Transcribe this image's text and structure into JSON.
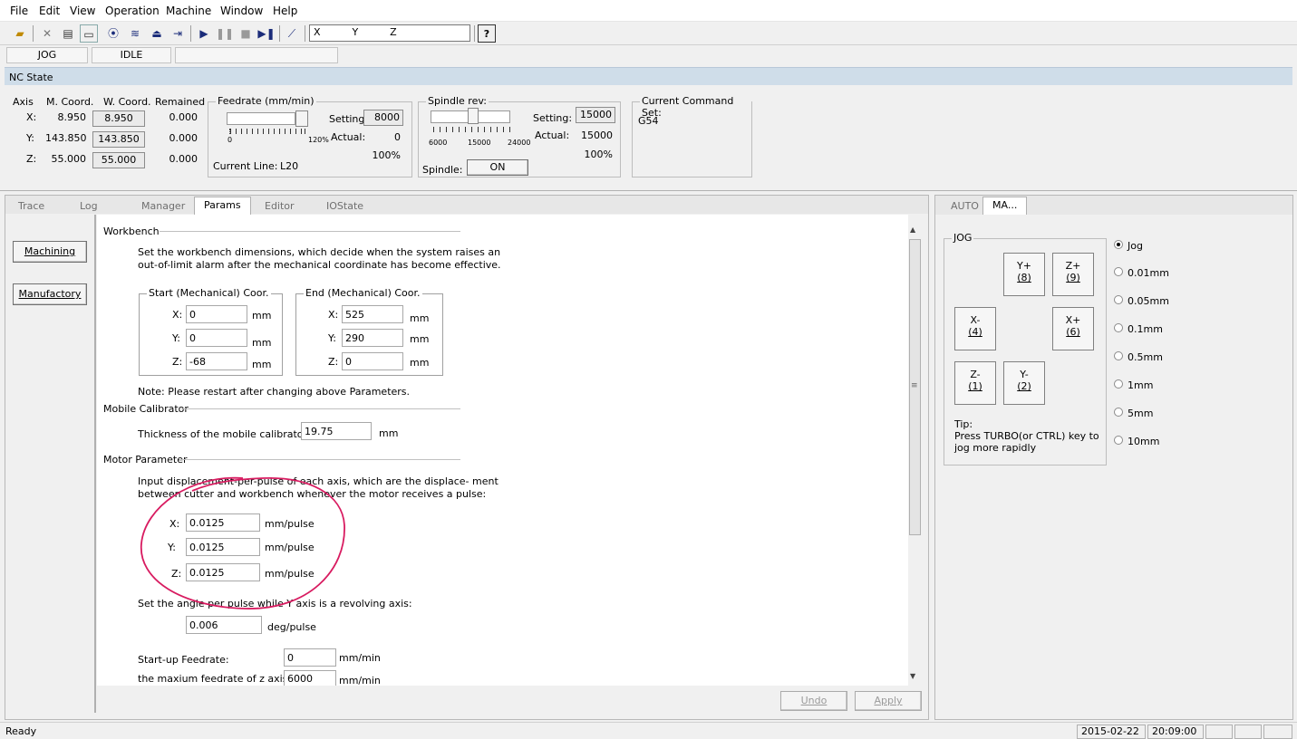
{
  "menu": [
    "File",
    "Edit",
    "View",
    "Operation",
    "Machine",
    "Window",
    "Help"
  ],
  "toolbar": {
    "axes_field": "X          Y          Z"
  },
  "state": {
    "mode": "JOG",
    "status": "IDLE"
  },
  "nc_state": {
    "title": "NC State"
  },
  "coords": {
    "h_axis": "Axis",
    "h_mcoord": "M. Coord.",
    "h_wcoord": "W. Coord.",
    "h_remained": "Remained",
    "rows": [
      {
        "axis": "X:",
        "m": "8.950",
        "w": "8.950",
        "r": "0.000"
      },
      {
        "axis": "Y:",
        "m": "143.850",
        "w": "143.850",
        "r": "0.000"
      },
      {
        "axis": "Z:",
        "m": "55.000",
        "w": "55.000",
        "r": "0.000"
      }
    ]
  },
  "feedrate": {
    "title": "Feedrate (mm/min)",
    "setting_label": "Setting:",
    "setting": "8000",
    "actual_label": "Actual:",
    "actual": "0",
    "percent": "100%",
    "scale_min": "0",
    "scale_max": "120%",
    "current_line_label": "Current Line:",
    "current_line": "L20"
  },
  "spindle": {
    "title": "Spindle rev:",
    "setting_label": "Setting:",
    "setting": "15000",
    "actual_label": "Actual:",
    "actual": "15000",
    "percent": "100%",
    "scale": [
      "6000",
      "15000",
      "24000"
    ],
    "spindle_label": "Spindle:",
    "spindle_btn": "ON"
  },
  "command_set": {
    "title": "Current Command Set:",
    "value": "G54"
  },
  "tabs": [
    "Trace",
    "Log",
    "Manager",
    "Params",
    "Editor",
    "IOState"
  ],
  "side_buttons": {
    "machining": "Machining",
    "manufactory": "Manufactory"
  },
  "workbench": {
    "title": "Workbench",
    "desc1": "Set the workbench dimensions, which decide when the system raises an",
    "desc2": "out-of-limit alarm after the mechanical coordinate has become effective.",
    "start_title": "Start (Mechanical) Coor.",
    "end_title": "End (Mechanical) Coor.",
    "start": [
      {
        "a": "X:",
        "v": "0"
      },
      {
        "a": "Y:",
        "v": "0"
      },
      {
        "a": "Z:",
        "v": "-68"
      }
    ],
    "end": [
      {
        "a": "X:",
        "v": "525"
      },
      {
        "a": "Y:",
        "v": "290"
      },
      {
        "a": "Z:",
        "v": "0"
      }
    ],
    "unit": "mm",
    "note": "Note: Please restart after changing above Parameters."
  },
  "calibrator": {
    "title": "Mobile Calibrator",
    "label": "Thickness of the mobile calibrator:",
    "value": "19.75",
    "unit": "mm"
  },
  "motor": {
    "title": "Motor Parameter",
    "desc1": "Input displacement-per-pulse of each axis, which are the displace- ment",
    "desc2": "between cutter and workbench whenever the motor receives a pulse:",
    "rows": [
      {
        "a": "X:",
        "v": "0.0125"
      },
      {
        "a": "Y:",
        "v": "0.0125"
      },
      {
        "a": "Z:",
        "v": "0.0125"
      }
    ],
    "unit": "mm/pulse",
    "angle_label": "Set the angle per pulse while Y axis is a revolving axis:",
    "angle_value": "0.006",
    "angle_unit": "deg/pulse",
    "startup_label": "Start-up Feedrate:",
    "startup_value": "0",
    "startup_unit": "mm/min",
    "maxz_label": "the maxium feedrate of z axis:",
    "maxz_value": "6000",
    "maxz_unit": "mm/min"
  },
  "bottom_buttons": {
    "undo": "Undo",
    "apply": "Apply"
  },
  "right_tabs": [
    "AUTO",
    "MA..."
  ],
  "jog": {
    "title": "JOG",
    "yplus": "Y+",
    "yplus_k": "(8)",
    "zplus": "Z+",
    "zplus_k": "(9)",
    "xminus": "X-",
    "xminus_k": "(4)",
    "xplus": "X+",
    "xplus_k": "(6)",
    "zminus": "Z-",
    "zminus_k": "(1)",
    "yminus": "Y-",
    "yminus_k": "(2)",
    "tip1": "Tip:",
    "tip2": "Press TURBO(or CTRL) key to",
    "tip3": "jog more rapidly"
  },
  "steps": [
    "Jog",
    "0.01mm",
    "0.05mm",
    "0.1mm",
    "0.5mm",
    "1mm",
    "5mm",
    "10mm"
  ],
  "selected_step": "Jog",
  "statusbar": {
    "ready": "Ready",
    "date": "2015-02-22",
    "time": "20:09:00"
  },
  "colors": {
    "header_band": "#cfdde9",
    "annotation": "#d81b60"
  }
}
